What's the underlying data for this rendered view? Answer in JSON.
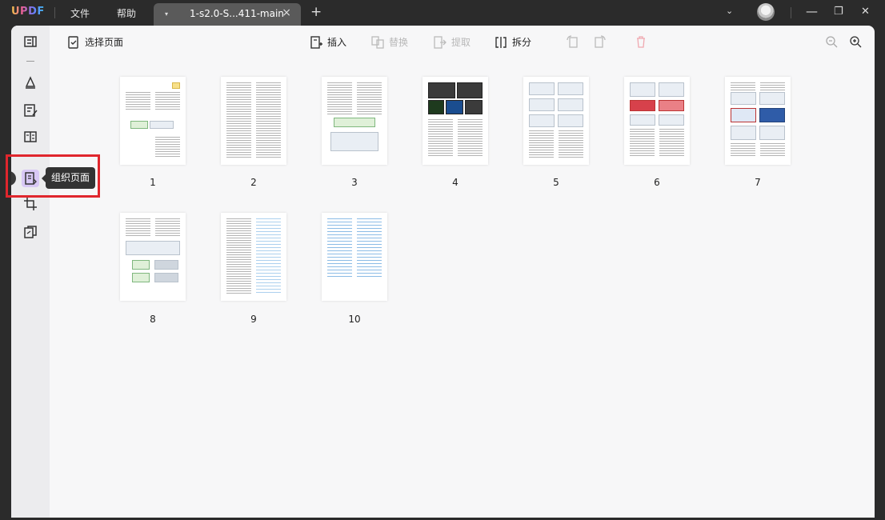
{
  "app": {
    "logo": "UPDF",
    "menu": [
      "文件",
      "帮助"
    ],
    "tab_title": "1-s2.0-S...411-main",
    "tab_close": "×",
    "new_tab": "+",
    "tab_dropdown": "▾",
    "window_controls": {
      "chevron": "⌄",
      "minimize": "—",
      "restore": "❐",
      "close": "✕"
    }
  },
  "toolbar": {
    "select_pages": "选择页面",
    "insert": "插入",
    "replace": "替换",
    "extract": "提取",
    "split": "拆分"
  },
  "sidebar": {
    "tooltip": "组织页面",
    "icons": [
      "reader-icon",
      "comment-icon",
      "edit-pdf-icon",
      "form-icon",
      "organize-pages-icon",
      "crop-icon",
      "convert-icon"
    ]
  },
  "pages": [
    {
      "num": "1"
    },
    {
      "num": "2"
    },
    {
      "num": "3"
    },
    {
      "num": "4"
    },
    {
      "num": "5"
    },
    {
      "num": "6"
    },
    {
      "num": "7"
    },
    {
      "num": "8"
    },
    {
      "num": "9"
    },
    {
      "num": "10"
    }
  ],
  "colors": {
    "accent": "#d8c8f5",
    "highlight_border": "#e0262d",
    "titlebar": "#2b2b2b"
  }
}
